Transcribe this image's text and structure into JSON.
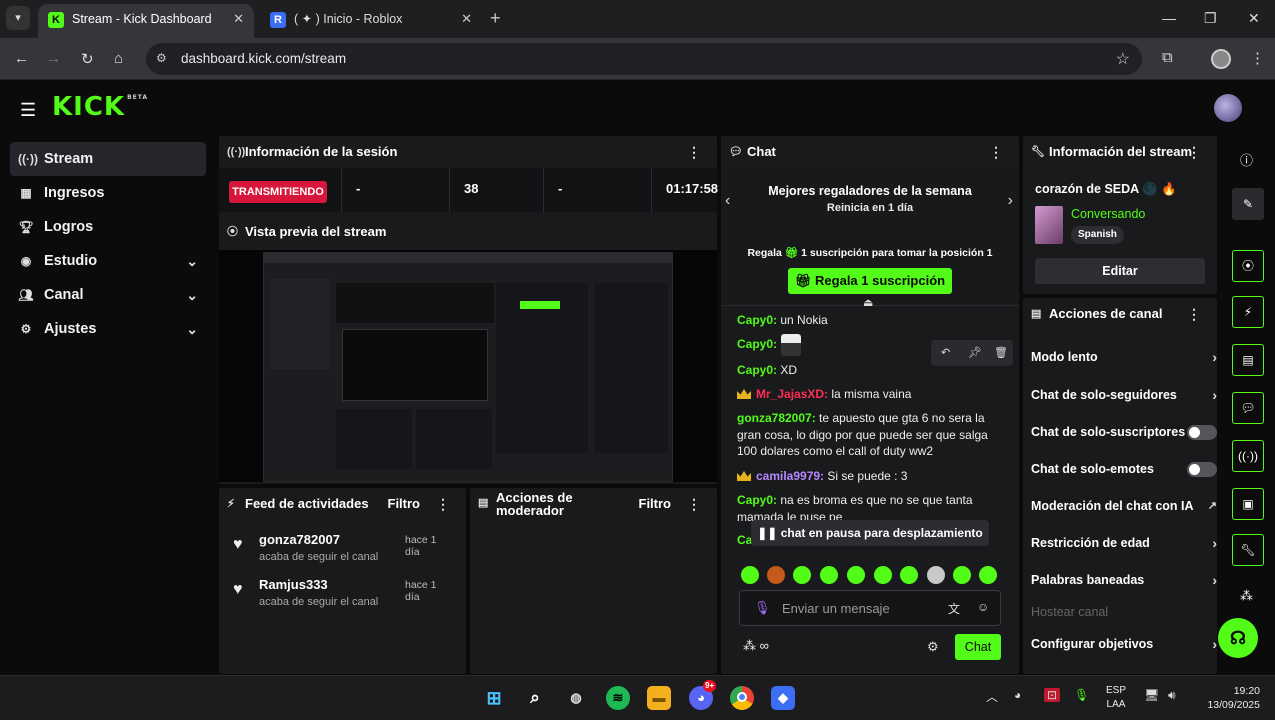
{
  "browser": {
    "tabs": [
      {
        "title": "Stream - Kick Dashboard",
        "favicon": "K"
      },
      {
        "title": "( ✦ ) Inicio - Roblox",
        "favicon": "R"
      }
    ],
    "url": "dashboard.kick.com/stream"
  },
  "brand": {
    "logo": "KICK",
    "beta": "BETA",
    "accent": "#53fc18"
  },
  "sidebar": {
    "items": [
      {
        "label": "Stream",
        "icon": "broadcast-icon"
      },
      {
        "label": "Ingresos",
        "icon": "chart-icon"
      },
      {
        "label": "Logros",
        "icon": "trophy-icon"
      },
      {
        "label": "Estudio",
        "icon": "studio-icon"
      },
      {
        "label": "Canal",
        "icon": "users-icon"
      },
      {
        "label": "Ajustes",
        "icon": "gear-icon"
      }
    ]
  },
  "session": {
    "title": "Información de la sesión",
    "status": "TRANSMITIENDO",
    "cells": [
      "-",
      "38",
      "-",
      "01:17:58"
    ]
  },
  "preview": {
    "title": "Vista previa del stream"
  },
  "feed": {
    "title": "Feed de actividades",
    "filter": "Filtro",
    "items": [
      {
        "user": "gonza782007",
        "action": "acaba de seguir el canal",
        "time": "hace 1 día"
      },
      {
        "user": "Ramjus333",
        "action": "acaba de seguir el canal",
        "time": "hace 1 día"
      }
    ]
  },
  "mod_actions": {
    "title": "Acciones de moderador",
    "filter": "Filtro"
  },
  "chat": {
    "title": "Chat",
    "leaderboard_title": "Mejores regaladores de la semana",
    "leaderboard_sub": "Reinicia en 1 día",
    "regala_prefix": "Regala",
    "regala_sub": "1 suscripción",
    "regala_suffix": "para tomar la posición 1",
    "gift_button": "Regala 1 suscripción",
    "messages": [
      {
        "user": "Capy0:",
        "text": "un Nokia",
        "color": "#53fc18"
      },
      {
        "user": "Capy0:",
        "text": "",
        "color": "#53fc18"
      },
      {
        "user": "Capy0:",
        "text": "XD",
        "color": "#53fc18"
      },
      {
        "user": "Mr_JajasXD:",
        "text": "la misma vaina",
        "color": "#ff2d55"
      },
      {
        "user": "gonza782007:",
        "text": "te apuesto que gta 6 no sera la gran cosa, lo digo por que puede ser que salga 100 dolares como el call of duty ww2",
        "color": "#53fc18"
      },
      {
        "user": "camila9979:",
        "text": "Si se puede : 3",
        "color": "#b887ff"
      },
      {
        "user": "Capy0:",
        "text": "na es broma es que no se que tanta mamada le puse pe",
        "color": "#53fc18"
      },
      {
        "user": "Ca",
        "text": "",
        "color": "#53fc18"
      }
    ],
    "paused": "chat en pausa para desplazamiento",
    "input_placeholder": "Enviar un mensaje",
    "send_button": "Chat"
  },
  "stream_info": {
    "title": "Información del stream",
    "stream_title": "corazón de SEDA 🌑 🔥",
    "category": "Conversando",
    "language": "Spanish",
    "edit_button": "Editar"
  },
  "channel_actions": {
    "title": "Acciones de canal",
    "items": [
      {
        "label": "Modo lento",
        "control": "chevron"
      },
      {
        "label": "Chat de solo-seguidores",
        "control": "chevron"
      },
      {
        "label": "Chat de solo-suscriptores",
        "control": "toggle"
      },
      {
        "label": "Chat de solo-emotes",
        "control": "toggle"
      },
      {
        "label": "Moderación del chat con IA",
        "control": "external"
      },
      {
        "label": "Restricción de edad",
        "control": "chevron"
      },
      {
        "label": "Palabras baneadas",
        "control": "chevron"
      },
      {
        "label": "Hostear canal",
        "control": "disabled"
      },
      {
        "label": "Configurar objetivos",
        "control": "chevron"
      }
    ]
  },
  "taskbar": {
    "lang": "ESP",
    "layout": "LAA",
    "time": "19:20",
    "date": "13/09/2025",
    "badge": "9+"
  }
}
